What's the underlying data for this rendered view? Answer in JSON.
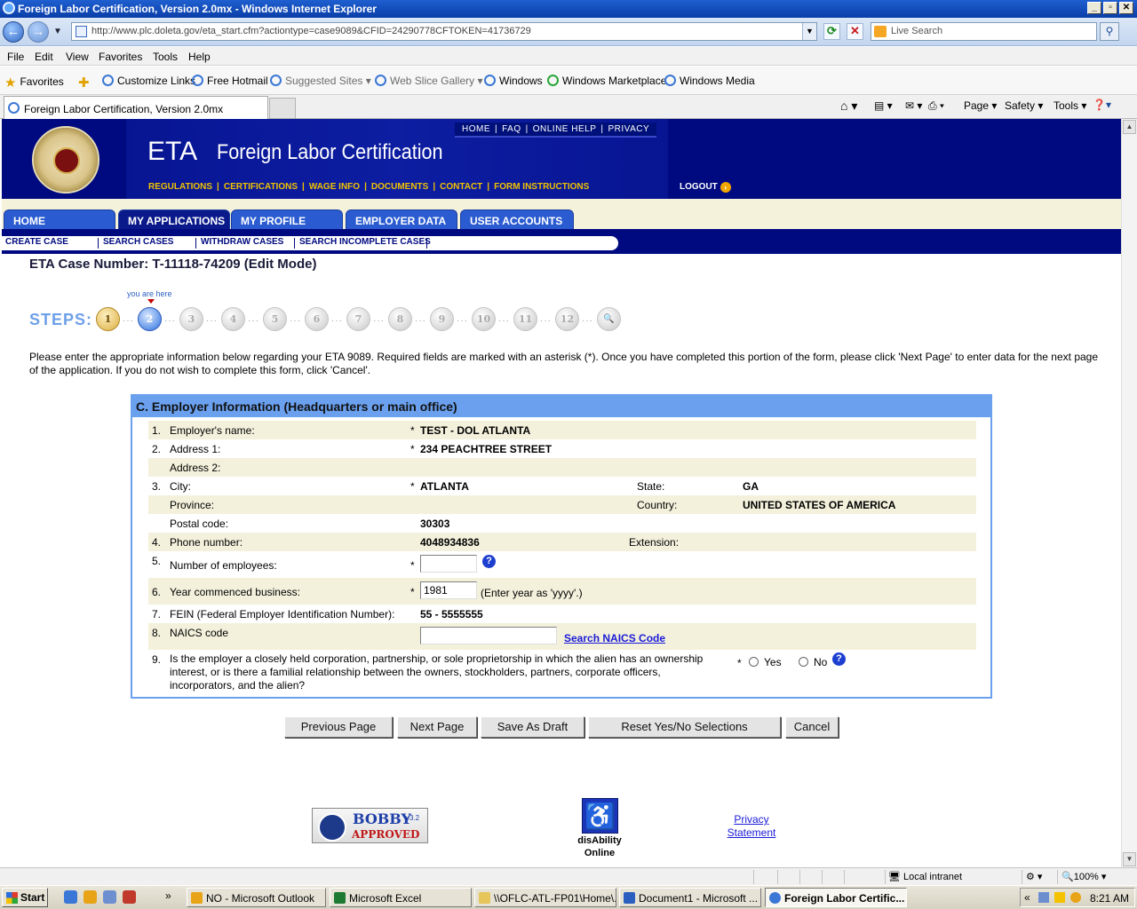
{
  "window": {
    "title": "Foreign Labor Certification, Version 2.0mx - Windows Internet Explorer"
  },
  "browser": {
    "url": "http://www.plc.doleta.gov/eta_start.cfm?actiontype=case9089&CFID=24290778CFTOKEN=41736729",
    "search_placeholder": "Live Search",
    "menu": [
      "File",
      "Edit",
      "View",
      "Favorites",
      "Tools",
      "Help"
    ],
    "favorites_label": "Favorites",
    "favorites": [
      "Customize Links",
      "Free Hotmail",
      "Suggested Sites",
      "Web Slice Gallery",
      "Windows",
      "Windows Marketplace",
      "Windows Media"
    ],
    "tab_title": "Foreign Labor Certification, Version 2.0mx",
    "commands": [
      "Page",
      "Safety",
      "Tools"
    ]
  },
  "site": {
    "brand": "ETA",
    "subtitle": "Foreign Labor Certification",
    "top_links": [
      "HOME",
      "FAQ",
      "ONLINE HELP",
      "PRIVACY"
    ],
    "nav_links": [
      "REGULATIONS",
      "CERTIFICATIONS",
      "WAGE INFO",
      "DOCUMENTS",
      "CONTACT",
      "FORM INSTRUCTIONS"
    ],
    "logout": "LOGOUT",
    "tabs": [
      "HOME",
      "MY APPLICATIONS",
      "MY PROFILE",
      "EMPLOYER DATA",
      "USER ACCOUNTS"
    ],
    "active_tab": "MY APPLICATIONS",
    "sub_links": [
      "CREATE CASE",
      "SEARCH CASES",
      "WITHDRAW CASES",
      "SEARCH INCOMPLETE CASES"
    ]
  },
  "case": {
    "title": "ETA Case Number: T-11118-74209  (Edit Mode)"
  },
  "steps": {
    "label": "STEPS:",
    "you_are_here": "you are here",
    "items": [
      "1",
      "2",
      "3",
      "4",
      "5",
      "6",
      "7",
      "8",
      "9",
      "10",
      "11",
      "12"
    ],
    "current": 2
  },
  "intro": "Please enter the appropriate information below regarding your ETA 9089. Required fields are marked with an asterisk (*). Once you have completed this portion of the form, please click 'Next Page' to enter data for the next page of the application. If you do not wish to complete this form, click 'Cancel'.",
  "section": {
    "title": "C. Employer Information (Headquarters or main office)",
    "rows": {
      "employer_name": {
        "num": "1.",
        "label": "Employer's name:",
        "value": "TEST - DOL ATLANTA"
      },
      "address1": {
        "num": "2.",
        "label": "Address 1:",
        "value": "234 PEACHTREE STREET"
      },
      "address2": {
        "label": "Address 2:"
      },
      "city": {
        "num": "3.",
        "label": "City:",
        "value": "ATLANTA",
        "state_label": "State:",
        "state_value": "GA"
      },
      "province": {
        "label": "Province:",
        "country_label": "Country:",
        "country_value": "UNITED STATES OF AMERICA"
      },
      "postal": {
        "label": "Postal code:",
        "value": "30303"
      },
      "phone": {
        "num": "4.",
        "label": "Phone number:",
        "value": "4048934836",
        "ext_label": "Extension:"
      },
      "employees": {
        "num": "5.",
        "label": "Number of employees:",
        "value": ""
      },
      "year": {
        "num": "6.",
        "label": "Year commenced business:",
        "value": "1981",
        "hint": "(Enter year as 'yyyy'.)"
      },
      "fein": {
        "num": "7.",
        "label": "FEIN (Federal Employer Identification Number):",
        "value": "55 - 5555555"
      },
      "naics": {
        "num": "8.",
        "label": "NAICS code",
        "value": "",
        "link": "Search NAICS Code"
      },
      "ownership": {
        "num": "9.",
        "label_l1": "Is the employer a closely held corporation, partnership, or sole proprietorship in which the alien has an ownership",
        "label_l2": "interest, or is there a familial relationship between the owners, stockholders, partners, corporate officers,",
        "label_l3": "incorporators, and the alien?",
        "yes": "Yes",
        "no": "No"
      }
    }
  },
  "buttons": [
    "Previous Page",
    "Next Page",
    "Save As Draft",
    "Reset Yes/No Selections",
    "Cancel"
  ],
  "footer": {
    "bobby_line1": "BOBBY",
    "bobby_version": "v3.2",
    "bobby_line2": "APPROVED",
    "disability_l1": "disAbility",
    "disability_l2": "Online",
    "privacy_l1": "Privacy",
    "privacy_l2": "Statement"
  },
  "status": {
    "zone": "Local intranet",
    "zoom": "100%"
  },
  "taskbar": {
    "start": "Start",
    "tasks": [
      "NO - Microsoft Outlook",
      "Microsoft Excel",
      "\\\\OFLC-ATL-FP01\\Home\\...",
      "Document1 - Microsoft ...",
      "Foreign Labor Certific..."
    ],
    "time": "8:21 AM"
  }
}
